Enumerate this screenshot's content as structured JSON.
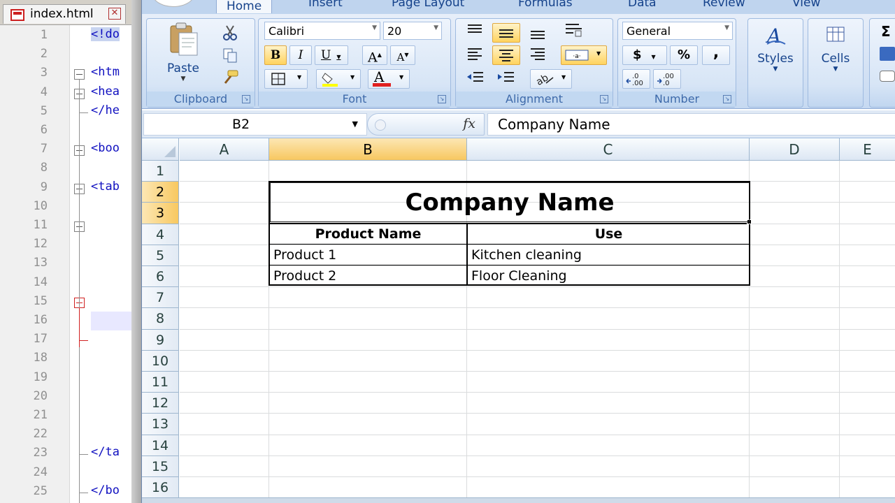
{
  "editor": {
    "tab_label": "index.html",
    "line_numbers": [
      "1",
      "2",
      "3",
      "4",
      "5",
      "6",
      "7",
      "8",
      "9",
      "10",
      "11",
      "12",
      "13",
      "14",
      "15",
      "16",
      "17",
      "18",
      "19",
      "20",
      "21",
      "22",
      "23",
      "24",
      "25"
    ],
    "code_lines": [
      {
        "line": 1,
        "text": "<!do"
      },
      {
        "line": 3,
        "text": "<htm"
      },
      {
        "line": 4,
        "text": "<hea"
      },
      {
        "line": 5,
        "text": "</he"
      },
      {
        "line": 7,
        "text": "<boo"
      },
      {
        "line": 9,
        "text": "<tab"
      },
      {
        "line": 23,
        "text": "</ta"
      },
      {
        "line": 25,
        "text": "</bo"
      }
    ]
  },
  "excel": {
    "ribbon_tabs": [
      "Home",
      "Insert",
      "Page Layout",
      "Formulas",
      "Data",
      "Review",
      "View"
    ],
    "active_tab": "Home",
    "groups": {
      "clipboard": {
        "label": "Clipboard",
        "paste_label": "Paste"
      },
      "font": {
        "label": "Font",
        "font_name": "Calibri",
        "font_size": "20",
        "bold": "B",
        "italic": "I",
        "underline": "U",
        "grow": "A",
        "shrink": "A",
        "font_color_letter": "A"
      },
      "alignment": {
        "label": "Alignment"
      },
      "number": {
        "label": "Number",
        "format": "General",
        "currency": "$",
        "percent": "%",
        "comma": ","
      },
      "styles": {
        "label": "Styles"
      },
      "cells": {
        "label": "Cells"
      },
      "editing": {
        "sigma": "Σ"
      }
    },
    "colors": {
      "accent": "#15428b",
      "selected_header": "#f8c860",
      "ribbon_bg": "#c6d9f1",
      "font_color_bar": "#e02020",
      "fill_color_bar": "#ffff00"
    },
    "formula_bar": {
      "name_box": "B2",
      "fx": "fx",
      "formula": "Company Name"
    },
    "columns": [
      "A",
      "B",
      "C",
      "D",
      "E"
    ],
    "selected_column": "B",
    "rows": [
      "1",
      "2",
      "3",
      "4",
      "5",
      "6",
      "7",
      "8",
      "9",
      "10",
      "11",
      "12",
      "13",
      "14",
      "15",
      "16"
    ],
    "selected_rows": [
      "2",
      "3"
    ],
    "table": {
      "title": "Company Name",
      "headers": [
        "Product Name",
        "Use"
      ],
      "data": [
        [
          "Product 1",
          "Kitchen cleaning"
        ],
        [
          "Product 2",
          "Floor Cleaning"
        ]
      ]
    }
  }
}
